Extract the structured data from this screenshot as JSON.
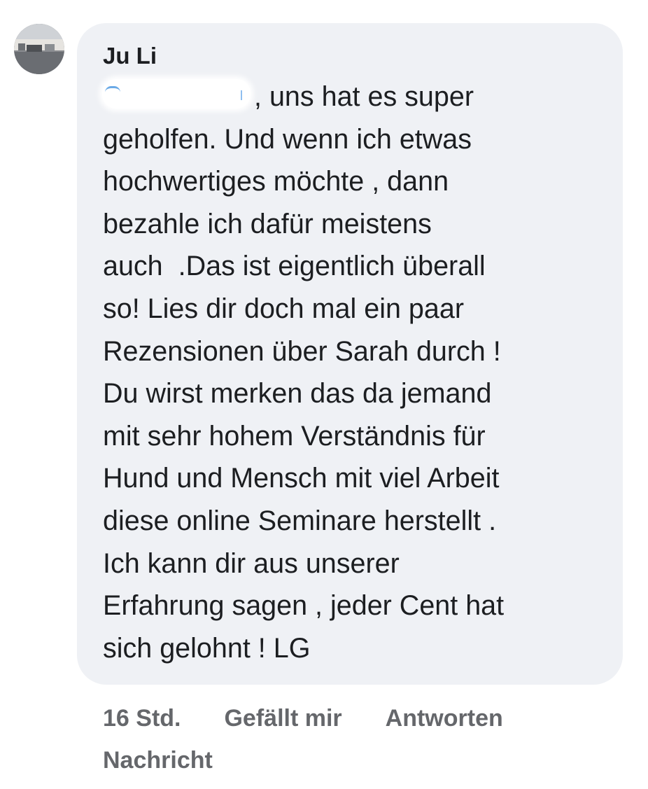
{
  "comment": {
    "author": "Ju Li",
    "text_lines": [
      ", uns hat es super",
      "geholfen. Und wenn ich etwas",
      "hochwertiges möchte , dann",
      "bezahle ich dafür meistens",
      "auch  .Das ist eigentlich überall",
      "so! Lies dir doch mal ein paar",
      "Rezensionen über Sarah durch !",
      "Du wirst merken das da jemand",
      "mit sehr hohem Verständnis für",
      "Hund und Mensch mit viel Arbeit",
      "diese online Seminare herstellt .",
      "Ich kann dir aus unserer",
      "Erfahrung sagen , jeder Cent hat",
      "sich gelohnt ! LG"
    ]
  },
  "actions": {
    "timestamp": "16 Std.",
    "like_label": "Gefällt mir",
    "reply_label": "Antworten",
    "message_label": "Nachricht"
  },
  "colors": {
    "bubble_background": "#eff1f5",
    "text": "#1c1e21",
    "action_text": "#65676b"
  }
}
